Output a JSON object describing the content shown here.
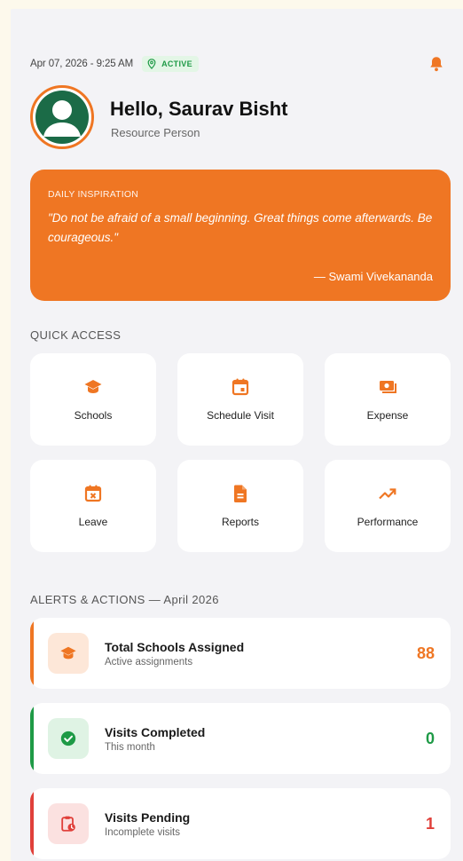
{
  "header": {
    "datetime": "Apr 07, 2026 - 9:25 AM",
    "status_badge": "ACTIVE"
  },
  "profile": {
    "greeting": "Hello, Saurav Bisht",
    "role": "Resource Person"
  },
  "inspiration": {
    "kicker": "DAILY INSPIRATION",
    "quote": "\"Do not be afraid of a small beginning. Great things come afterwards. Be courageous.\"",
    "author": "— Swami Vivekananda"
  },
  "quick_access": {
    "title": "QUICK ACCESS",
    "items": [
      {
        "label": "Schools",
        "icon": "graduation-cap-icon"
      },
      {
        "label": "Schedule Visit",
        "icon": "calendar-icon"
      },
      {
        "label": "Expense",
        "icon": "cash-icon"
      },
      {
        "label": "Leave",
        "icon": "calendar-x-icon"
      },
      {
        "label": "Reports",
        "icon": "document-icon"
      },
      {
        "label": "Performance",
        "icon": "trending-up-icon"
      }
    ]
  },
  "alerts": {
    "title": "ALERTS & ACTIONS — April 2026",
    "items": [
      {
        "title": "Total Schools Assigned",
        "subtitle": "Active assignments",
        "value": "88",
        "color": "#ef7623",
        "icon": "graduation-cap-icon"
      },
      {
        "title": "Visits Completed",
        "subtitle": "This month",
        "value": "0",
        "color": "#1e9a46",
        "icon": "check-circle-icon"
      },
      {
        "title": "Visits Pending",
        "subtitle": "Incomplete visits",
        "value": "1",
        "color": "#e0403a",
        "icon": "clipboard-clock-icon"
      }
    ]
  },
  "colors": {
    "accent": "#ef7623",
    "success": "#1e9a46",
    "danger": "#e0403a",
    "background": "#f3f3f6"
  }
}
